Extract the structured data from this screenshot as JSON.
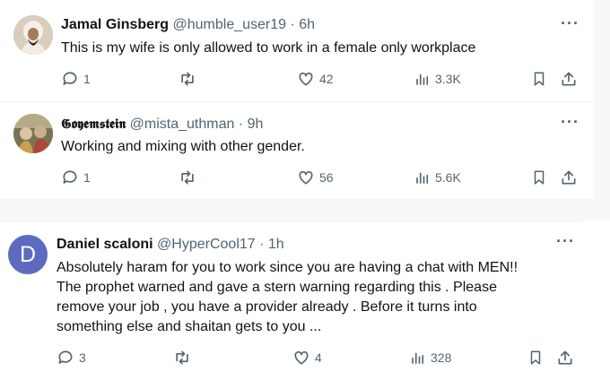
{
  "tweets": [
    {
      "name": "Jamal Ginsberg",
      "handle": "@humble_user19",
      "separator": "·",
      "time": "6h",
      "text": "This is my wife is only allowed to work in a female only workplace",
      "replies": "1",
      "likes": "42",
      "views": "3.3K"
    },
    {
      "name": "𝕲𝖔𝖞𝖊𝖒𝖘𝖙𝖊𝖎𝖓",
      "handle": "@mista_uthman",
      "separator": "·",
      "time": "9h",
      "text": "Working and mixing with other gender.",
      "replies": "1",
      "likes": "56",
      "views": "5.6K"
    },
    {
      "name": "Daniel scaloni",
      "handle": "@HyperCool17",
      "separator": "·",
      "time": "1h",
      "avatar_letter": "D",
      "text_lines": [
        "Absolutely haram for you to work since you are having a chat with MEN!!",
        "The prophet warned and gave a stern warning regarding this . Please",
        "remove your job , you have a provider already . Before it turns into",
        "something else and shaitan gets to you ..."
      ],
      "replies": "3",
      "likes": "4",
      "views": "328"
    }
  ],
  "more_label": "···",
  "colors": {
    "text": "#0f1419",
    "muted": "#536471",
    "avatar_d": "#5c6bc0",
    "divider": "#f7f9f9"
  },
  "icons": [
    "reply-icon",
    "retweet-icon",
    "like-icon",
    "views-icon",
    "bookmark-icon",
    "share-icon",
    "more-icon"
  ]
}
